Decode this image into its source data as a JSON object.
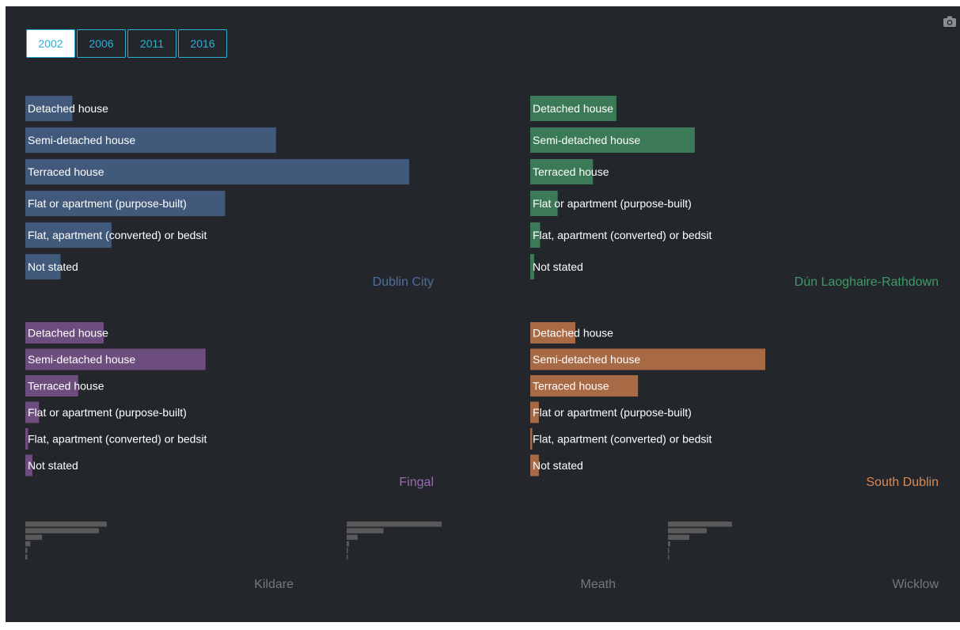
{
  "tabs": [
    {
      "label": "2002",
      "active": true
    },
    {
      "label": "2006",
      "active": false
    },
    {
      "label": "2011",
      "active": false
    },
    {
      "label": "2016",
      "active": false
    }
  ],
  "icons": {
    "toolbar": "camera-icon"
  },
  "colors": {
    "background": "#23272c",
    "accent": "#2bb0d4",
    "dublin_city": "#41597a",
    "dun_laoghaire": "#3c7a57",
    "fingal": "#6d4d7d",
    "south_dublin": "#a86a45",
    "minor": "#5a5a5a",
    "minor_label": "#777777"
  },
  "chart_data": [
    {
      "type": "bar",
      "title": "Dublin City",
      "color": "#41597a",
      "categories": [
        "Detached house",
        "Semi-detached house",
        "Terraced house",
        "Flat or apartment (purpose-built)",
        "Flat, apartment (converted) or bedsit",
        "Not stated"
      ],
      "values": [
        12,
        64,
        98,
        51,
        22,
        9
      ]
    },
    {
      "type": "bar",
      "title": "Dún Laoghaire-Rathdown",
      "color": "#3c7a57",
      "categories": [
        "Detached house",
        "Semi-detached house",
        "Terraced house",
        "Flat or apartment (purpose-built)",
        "Flat, apartment (converted) or bedsit",
        "Not stated"
      ],
      "values": [
        22,
        42,
        16,
        7,
        2.5,
        1
      ]
    },
    {
      "type": "bar",
      "title": "Fingal",
      "color": "#6d4d7d",
      "categories": [
        "Detached house",
        "Semi-detached house",
        "Terraced house",
        "Flat or apartment (purpose-built)",
        "Flat, apartment (converted) or bedsit",
        "Not stated"
      ],
      "values": [
        20,
        46,
        13.5,
        3.5,
        0.7,
        1.8
      ]
    },
    {
      "type": "bar",
      "title": "South Dublin",
      "color": "#a86a45",
      "categories": [
        "Detached house",
        "Semi-detached house",
        "Terraced house",
        "Flat or apartment (purpose-built)",
        "Flat, apartment (converted) or bedsit",
        "Not stated"
      ],
      "values": [
        11.5,
        60,
        27.5,
        2.2,
        0.5,
        2.2
      ]
    },
    {
      "type": "bar",
      "title": "Kildare",
      "color": "#5a5a5a",
      "values": [
        21,
        19,
        4.3,
        1.3,
        0.5,
        0.5
      ]
    },
    {
      "type": "bar",
      "title": "Meath",
      "color": "#5a5a5a",
      "values": [
        24.5,
        9.5,
        2.8,
        0.6,
        0.3,
        0.3
      ]
    },
    {
      "type": "bar",
      "title": "Wicklow",
      "color": "#5a5a5a",
      "values": [
        16.5,
        10,
        5.5,
        0.6,
        0.3,
        0.3
      ]
    }
  ]
}
